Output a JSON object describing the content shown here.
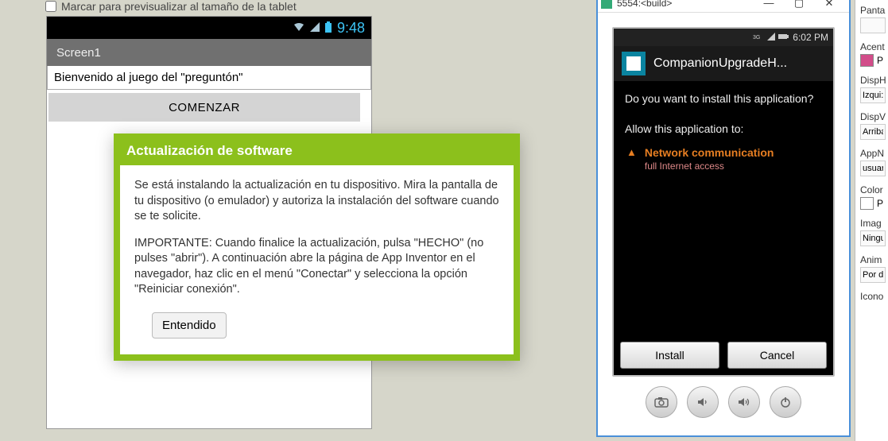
{
  "viewer": {
    "tablet_checkbox_label": "Marcar para previsualizar al tamaño de la tablet",
    "tablet_checked": false,
    "statusbar": {
      "clock": "9:48"
    },
    "screen_title": "Screen1",
    "welcome_text": "Bienvenido al juego del \"preguntón\"",
    "comenzar_label": "COMENZAR"
  },
  "modal": {
    "title": "Actualización de software",
    "p1": "Se está instalando la actualización en tu dispositivo. Mira la pantalla de tu dispositivo (o emulador) y autoriza la instalación del software cuando se te solicite.",
    "p2": "IMPORTANTE: Cuando finalice la actualización, pulsa \"HECHO\" (no pulses \"abrir\"). A continuación abre la página de App Inventor en el navegador, haz clic en el menú \"Conectar\" y selecciona la opción \"Reiniciar conexión\".",
    "ok_label": "Entendido"
  },
  "emulator": {
    "window_title": "5554:<build>",
    "android_clock": "6:02 PM",
    "apk_name": "CompanionUpgradeH...",
    "question": "Do you want to install this application?",
    "allow_label": "Allow this application to:",
    "perm_title": "Network communication",
    "perm_sub": "full Internet access",
    "install_label": "Install",
    "cancel_label": "Cancel"
  },
  "props": {
    "p0_label": "Panta",
    "p1_label": "Acent",
    "p1_value": "P",
    "p1_color": "#d24d8a",
    "p2_label": "DispH",
    "p2_value": "Izqui:",
    "p3_label": "DispV",
    "p3_value": "Arriba",
    "p4_label": "AppN",
    "p4_value": "usuar",
    "p5_label": "Color",
    "p5_value": "P",
    "p5_color": "#ffffff",
    "p6_label": "Imag",
    "p6_value": "Ningu",
    "p7_label": "Anim",
    "p7_value": "Por d",
    "p8_label": "Icono"
  }
}
